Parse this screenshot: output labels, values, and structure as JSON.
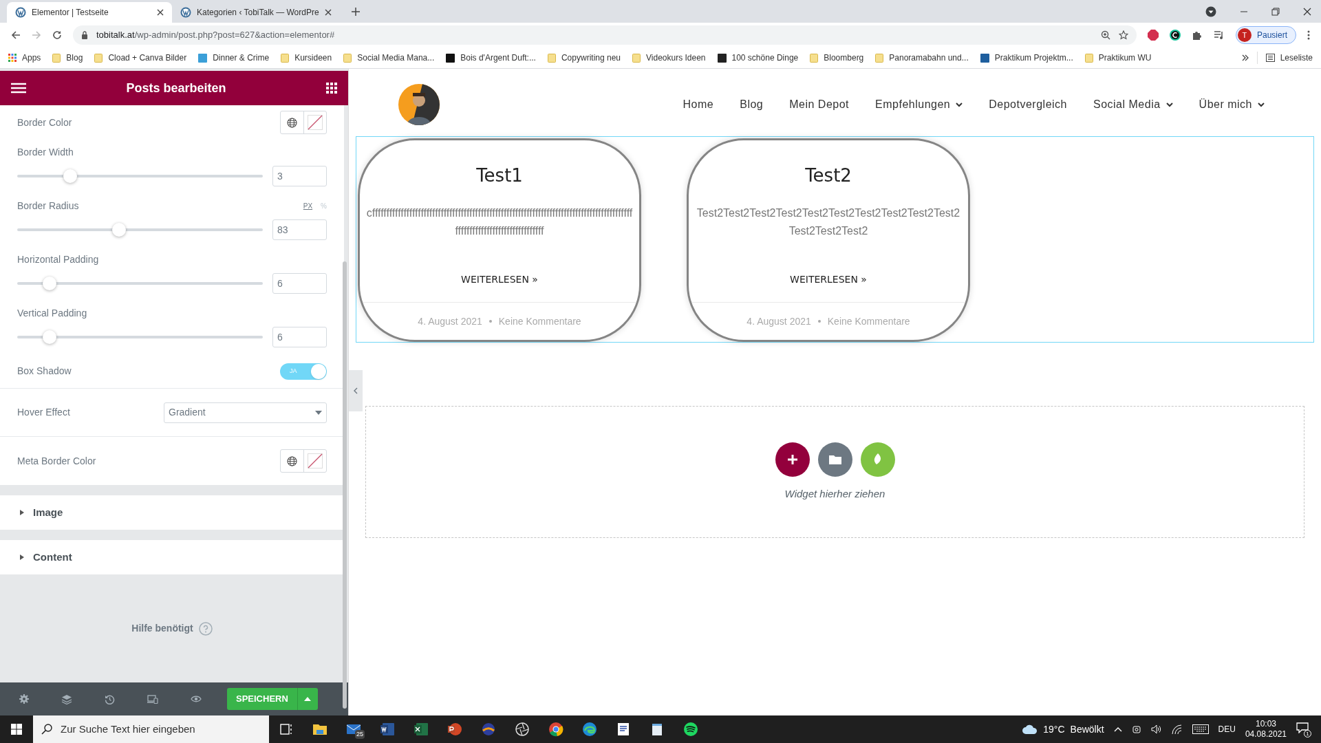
{
  "browser": {
    "tabs": [
      {
        "title": "Elementor | Testseite",
        "selected": true
      },
      {
        "title": "Kategorien ‹ TobiTalk — WordPre",
        "selected": false
      }
    ],
    "url_host": "tobitalk.at",
    "url_path": "/wp-admin/post.php?post=627&action=elementor#",
    "profile_initial": "T",
    "profile_label": "Pausiert",
    "bookmarks": [
      {
        "label": "Apps",
        "kind": "apps"
      },
      {
        "label": "Blog",
        "kind": "folder"
      },
      {
        "label": "Cload + Canva Bilder",
        "kind": "folder"
      },
      {
        "label": "Dinner & Crime",
        "kind": "favicon",
        "color": "#3b9fd8"
      },
      {
        "label": "Kursideen",
        "kind": "folder"
      },
      {
        "label": "Social Media Mana...",
        "kind": "folder"
      },
      {
        "label": "Bois d'Argent Duft:...",
        "kind": "favicon",
        "color": "#111111"
      },
      {
        "label": "Copywriting neu",
        "kind": "folder"
      },
      {
        "label": "Videokurs Ideen",
        "kind": "folder"
      },
      {
        "label": "100 schöne Dinge",
        "kind": "favicon",
        "color": "#222222"
      },
      {
        "label": "Bloomberg",
        "kind": "folder"
      },
      {
        "label": "Panoramabahn und...",
        "kind": "folder"
      },
      {
        "label": "Praktikum Projektm...",
        "kind": "favicon",
        "color": "#1f5f9e"
      },
      {
        "label": "Praktikum WU",
        "kind": "folder"
      }
    ],
    "reading_list": "Leseliste"
  },
  "editor": {
    "title": "Posts bearbeiten",
    "controls": [
      {
        "kind": "color",
        "label": "Border Color"
      },
      {
        "kind": "slider",
        "label": "Border Width",
        "value": "3",
        "level": 0.2
      },
      {
        "kind": "slider",
        "label": "Border Radius",
        "value": "83",
        "level": 0.41,
        "units": [
          {
            "label": "PX",
            "selected": true
          },
          {
            "label": "%",
            "selected": false
          }
        ]
      },
      {
        "kind": "slider",
        "label": "Horizontal Padding",
        "value": "6",
        "level": 0.11
      },
      {
        "kind": "slider",
        "label": "Vertical Padding",
        "value": "6",
        "level": 0.11
      },
      {
        "kind": "switch",
        "label": "Box Shadow",
        "on": true,
        "on_label": "JA"
      },
      {
        "kind": "select",
        "label": "Hover Effect",
        "value": "Gradient"
      },
      {
        "kind": "color",
        "label": "Meta Border Color"
      }
    ],
    "sections": [
      {
        "label": "Image",
        "expanded": false
      },
      {
        "label": "Content",
        "expanded": false
      }
    ],
    "help": "Hilfe benötigt",
    "save": "SPEICHERN"
  },
  "site": {
    "nav": [
      {
        "label": "Home",
        "dropdown": false
      },
      {
        "label": "Blog",
        "dropdown": false
      },
      {
        "label": "Mein Depot",
        "dropdown": false
      },
      {
        "label": "Empfehlungen",
        "dropdown": true
      },
      {
        "label": "Depotvergleich",
        "dropdown": false
      },
      {
        "label": "Social Media",
        "dropdown": true
      },
      {
        "label": "Über mich",
        "dropdown": true
      }
    ],
    "posts": [
      {
        "title": "Test1",
        "excerpt": "cffffffffffffffffffffffffffffffffffffffffffffffffffffffffffffffffffffffffffffffffffffffffffffffffffffffffffffffffffffffffff",
        "read_more": "WEITERLESEN »",
        "date": "4. August 2021",
        "comments": "Keine Kommentare"
      },
      {
        "title": "Test2",
        "excerpt": "Test2Test2Test2Test2Test2Test2Test2Test2Test2Test2Test2Test2Test2",
        "read_more": "WEITERLESEN »",
        "date": "4. August 2021",
        "comments": "Keine Kommentare"
      }
    ],
    "dropzone": "Widget hierher ziehen"
  },
  "taskbar": {
    "search_placeholder": "Zur Suche Text hier eingeben",
    "mail_badge": "25",
    "temperature": "19°C",
    "weather": "Bewölkt",
    "language": "DEU",
    "time": "10:03",
    "date": "04.08.2021",
    "notifications": "1"
  }
}
